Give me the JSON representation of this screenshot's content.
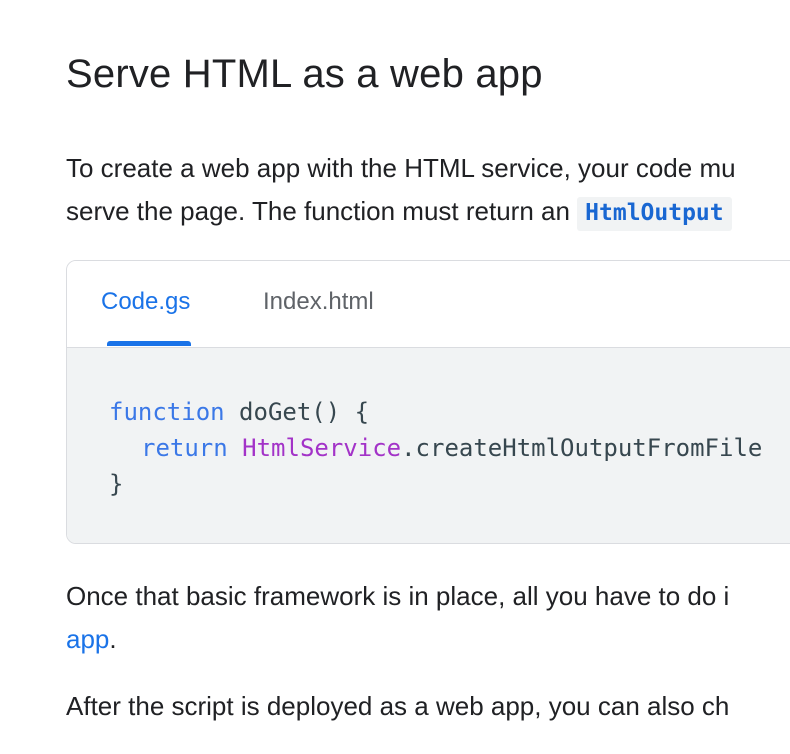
{
  "heading": "Serve HTML as a web app",
  "intro": {
    "line1": "To create a web app with the HTML service, your code mu",
    "line2_text": "serve the page. The function must return an ",
    "line2_code": "HtmlOutput"
  },
  "code_card": {
    "tabs": [
      {
        "label": "Code.gs",
        "active": true
      },
      {
        "label": "Index.html",
        "active": false
      }
    ],
    "code": {
      "line1_keyword": "function",
      "line1_rest": " doGet() {",
      "line2_indent": "  ",
      "line2_keyword": "return",
      "line2_space": " ",
      "line2_class": "HtmlService",
      "line2_rest": ".createHtmlOutputFromFile",
      "line3": "}"
    }
  },
  "para2": {
    "line1": "Once that basic framework is in place, all you have to do i",
    "link": "app",
    "after_link": "."
  },
  "para3": {
    "line1": "After the script is deployed as a web app, you can also ch"
  },
  "colors": {
    "accent": "#1a73e8",
    "code_bg": "#f1f3f4",
    "keyword": "#3b78e7",
    "class_name": "#a333c8",
    "text": "#202124"
  }
}
